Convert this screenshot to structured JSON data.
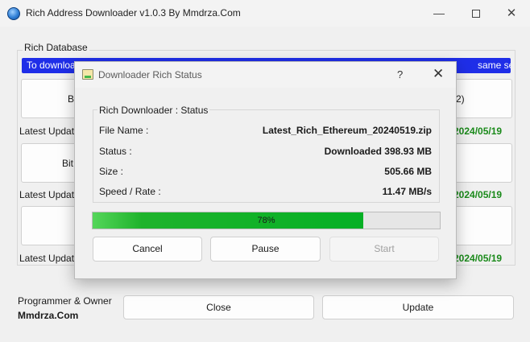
{
  "window": {
    "title": "Rich Address Downloader v1.0.3 By Mmdrza.Com",
    "controls": {
      "minimize": "—",
      "close": "✕"
    }
  },
  "main": {
    "group_label": "Rich Database",
    "banner_left": "To download",
    "banner_right": "same section",
    "buttons": [
      {
        "label": "B"
      },
      {
        "label": "2)"
      },
      {
        "label": "Bit"
      }
    ],
    "updates": [
      {
        "label": "Latest Update",
        "date": "2024/05/19"
      },
      {
        "label": "Latest Update",
        "date": "2024/05/19"
      },
      {
        "label": "Latest Update",
        "date": "2024/05/19"
      }
    ]
  },
  "footer": {
    "programmer_label": "Programmer & Owner",
    "programmer_name": "Mmdrza.Com",
    "close_label": "Close",
    "update_label": "Update"
  },
  "dialog": {
    "title": "Downloader Rich Status",
    "help": "?",
    "close": "✕",
    "group_label": "Rich Downloader : Status",
    "rows": [
      {
        "label": "File Name :",
        "value": "Latest_Rich_Ethereum_20240519.zip"
      },
      {
        "label": "Status :",
        "value": "Downloaded 398.93 MB"
      },
      {
        "label": "Size :",
        "value": "505.66 MB"
      },
      {
        "label": "Speed / Rate :",
        "value": "11.47 MB/s"
      }
    ],
    "progress": {
      "percent": 78,
      "text": "78%"
    },
    "buttons": {
      "cancel": "Cancel",
      "pause": "Pause",
      "start": "Start"
    }
  },
  "colors": {
    "banner": "#1f2ee8",
    "progress": "#06b025",
    "date": "#1a8a1a"
  }
}
